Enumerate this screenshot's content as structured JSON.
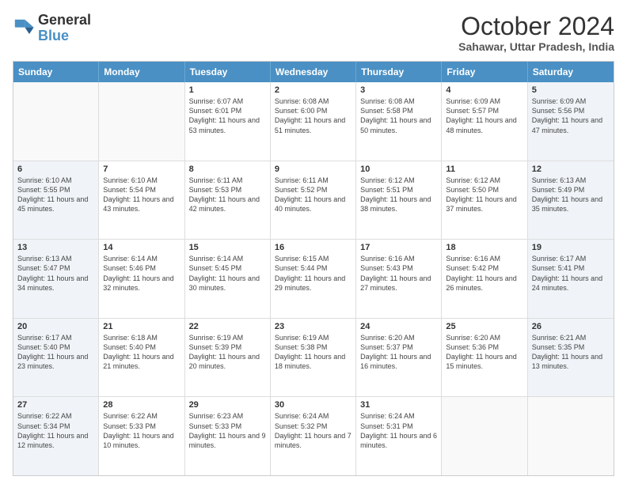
{
  "logo": {
    "line1": "General",
    "line2": "Blue"
  },
  "header": {
    "month": "October 2024",
    "location": "Sahawar, Uttar Pradesh, India"
  },
  "weekdays": [
    "Sunday",
    "Monday",
    "Tuesday",
    "Wednesday",
    "Thursday",
    "Friday",
    "Saturday"
  ],
  "weeks": [
    [
      {
        "day": "",
        "info": "",
        "shaded": false,
        "empty": true
      },
      {
        "day": "",
        "info": "",
        "shaded": false,
        "empty": true
      },
      {
        "day": "1",
        "info": "Sunrise: 6:07 AM\nSunset: 6:01 PM\nDaylight: 11 hours and 53 minutes.",
        "shaded": false
      },
      {
        "day": "2",
        "info": "Sunrise: 6:08 AM\nSunset: 6:00 PM\nDaylight: 11 hours and 51 minutes.",
        "shaded": false
      },
      {
        "day": "3",
        "info": "Sunrise: 6:08 AM\nSunset: 5:58 PM\nDaylight: 11 hours and 50 minutes.",
        "shaded": false
      },
      {
        "day": "4",
        "info": "Sunrise: 6:09 AM\nSunset: 5:57 PM\nDaylight: 11 hours and 48 minutes.",
        "shaded": false
      },
      {
        "day": "5",
        "info": "Sunrise: 6:09 AM\nSunset: 5:56 PM\nDaylight: 11 hours and 47 minutes.",
        "shaded": true
      }
    ],
    [
      {
        "day": "6",
        "info": "Sunrise: 6:10 AM\nSunset: 5:55 PM\nDaylight: 11 hours and 45 minutes.",
        "shaded": true
      },
      {
        "day": "7",
        "info": "Sunrise: 6:10 AM\nSunset: 5:54 PM\nDaylight: 11 hours and 43 minutes.",
        "shaded": false
      },
      {
        "day": "8",
        "info": "Sunrise: 6:11 AM\nSunset: 5:53 PM\nDaylight: 11 hours and 42 minutes.",
        "shaded": false
      },
      {
        "day": "9",
        "info": "Sunrise: 6:11 AM\nSunset: 5:52 PM\nDaylight: 11 hours and 40 minutes.",
        "shaded": false
      },
      {
        "day": "10",
        "info": "Sunrise: 6:12 AM\nSunset: 5:51 PM\nDaylight: 11 hours and 38 minutes.",
        "shaded": false
      },
      {
        "day": "11",
        "info": "Sunrise: 6:12 AM\nSunset: 5:50 PM\nDaylight: 11 hours and 37 minutes.",
        "shaded": false
      },
      {
        "day": "12",
        "info": "Sunrise: 6:13 AM\nSunset: 5:49 PM\nDaylight: 11 hours and 35 minutes.",
        "shaded": true
      }
    ],
    [
      {
        "day": "13",
        "info": "Sunrise: 6:13 AM\nSunset: 5:47 PM\nDaylight: 11 hours and 34 minutes.",
        "shaded": true
      },
      {
        "day": "14",
        "info": "Sunrise: 6:14 AM\nSunset: 5:46 PM\nDaylight: 11 hours and 32 minutes.",
        "shaded": false
      },
      {
        "day": "15",
        "info": "Sunrise: 6:14 AM\nSunset: 5:45 PM\nDaylight: 11 hours and 30 minutes.",
        "shaded": false
      },
      {
        "day": "16",
        "info": "Sunrise: 6:15 AM\nSunset: 5:44 PM\nDaylight: 11 hours and 29 minutes.",
        "shaded": false
      },
      {
        "day": "17",
        "info": "Sunrise: 6:16 AM\nSunset: 5:43 PM\nDaylight: 11 hours and 27 minutes.",
        "shaded": false
      },
      {
        "day": "18",
        "info": "Sunrise: 6:16 AM\nSunset: 5:42 PM\nDaylight: 11 hours and 26 minutes.",
        "shaded": false
      },
      {
        "day": "19",
        "info": "Sunrise: 6:17 AM\nSunset: 5:41 PM\nDaylight: 11 hours and 24 minutes.",
        "shaded": true
      }
    ],
    [
      {
        "day": "20",
        "info": "Sunrise: 6:17 AM\nSunset: 5:40 PM\nDaylight: 11 hours and 23 minutes.",
        "shaded": true
      },
      {
        "day": "21",
        "info": "Sunrise: 6:18 AM\nSunset: 5:40 PM\nDaylight: 11 hours and 21 minutes.",
        "shaded": false
      },
      {
        "day": "22",
        "info": "Sunrise: 6:19 AM\nSunset: 5:39 PM\nDaylight: 11 hours and 20 minutes.",
        "shaded": false
      },
      {
        "day": "23",
        "info": "Sunrise: 6:19 AM\nSunset: 5:38 PM\nDaylight: 11 hours and 18 minutes.",
        "shaded": false
      },
      {
        "day": "24",
        "info": "Sunrise: 6:20 AM\nSunset: 5:37 PM\nDaylight: 11 hours and 16 minutes.",
        "shaded": false
      },
      {
        "day": "25",
        "info": "Sunrise: 6:20 AM\nSunset: 5:36 PM\nDaylight: 11 hours and 15 minutes.",
        "shaded": false
      },
      {
        "day": "26",
        "info": "Sunrise: 6:21 AM\nSunset: 5:35 PM\nDaylight: 11 hours and 13 minutes.",
        "shaded": true
      }
    ],
    [
      {
        "day": "27",
        "info": "Sunrise: 6:22 AM\nSunset: 5:34 PM\nDaylight: 11 hours and 12 minutes.",
        "shaded": true
      },
      {
        "day": "28",
        "info": "Sunrise: 6:22 AM\nSunset: 5:33 PM\nDaylight: 11 hours and 10 minutes.",
        "shaded": false
      },
      {
        "day": "29",
        "info": "Sunrise: 6:23 AM\nSunset: 5:33 PM\nDaylight: 11 hours and 9 minutes.",
        "shaded": false
      },
      {
        "day": "30",
        "info": "Sunrise: 6:24 AM\nSunset: 5:32 PM\nDaylight: 11 hours and 7 minutes.",
        "shaded": false
      },
      {
        "day": "31",
        "info": "Sunrise: 6:24 AM\nSunset: 5:31 PM\nDaylight: 11 hours and 6 minutes.",
        "shaded": false
      },
      {
        "day": "",
        "info": "",
        "shaded": false,
        "empty": true
      },
      {
        "day": "",
        "info": "",
        "shaded": false,
        "empty": true
      }
    ]
  ]
}
